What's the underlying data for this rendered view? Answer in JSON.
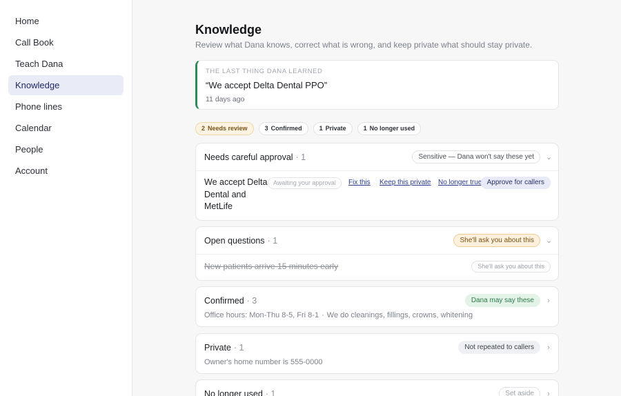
{
  "sidebar": {
    "items": [
      {
        "label": "Home"
      },
      {
        "label": "Call Book"
      },
      {
        "label": "Teach Dana"
      },
      {
        "label": "Knowledge"
      },
      {
        "label": "Phone lines"
      },
      {
        "label": "Calendar"
      },
      {
        "label": "People"
      },
      {
        "label": "Account"
      }
    ]
  },
  "page": {
    "title": "Knowledge",
    "subtitle": "Review what Dana knows, correct what is wrong, and keep private what should stay private."
  },
  "last_learned": {
    "eyebrow": "The last thing Dana learned",
    "quote": "“We accept Delta Dental PPO”",
    "when": "11 days ago"
  },
  "filters": [
    {
      "count": "2",
      "label": "Needs review"
    },
    {
      "count": "3",
      "label": "Confirmed"
    },
    {
      "count": "1",
      "label": "Private"
    },
    {
      "count": "1",
      "label": "No longer used"
    }
  ],
  "sections": {
    "approval": {
      "title": "Needs careful approval",
      "count": "· 1",
      "badge": "Sensitive — Dana won't say these yet",
      "chevron": "⌄",
      "item": {
        "text": "We accept Delta Dental and MetLife",
        "status": "Awaiting your approval",
        "fix": "Fix this",
        "keep_private": "Keep this private",
        "no_longer_true": "No longer true",
        "approve": "Approve for callers"
      }
    },
    "questions": {
      "title": "Open questions",
      "count": "· 1",
      "badge": "She'll ask you about this",
      "chevron": "⌄",
      "item": {
        "text": "New patients arrive 15 minutes early",
        "status": "She'll ask you about this"
      }
    },
    "confirmed": {
      "title": "Confirmed",
      "count": "· 3",
      "badge": "Dana may say these",
      "chevron": "›",
      "summary_a": "Office hours: Mon-Thu 8-5, Fri 8-1",
      "summary_sep": "·",
      "summary_b": "We do cleanings, fillings, crowns, whitening"
    },
    "private": {
      "title": "Private",
      "count": "· 1",
      "badge": "Not repeated to callers",
      "chevron": "›",
      "summary": "Owner's home number is 555-0000"
    },
    "retired": {
      "title": "No longer used",
      "count": "· 1",
      "badge": "Set aside",
      "chevron": "›"
    }
  },
  "colors": {
    "accent_green": "#2f8a57",
    "nav_active_bg": "#e9ebf7",
    "amber_bg": "#fdf0dc",
    "link_blue": "#2a3a8f"
  }
}
